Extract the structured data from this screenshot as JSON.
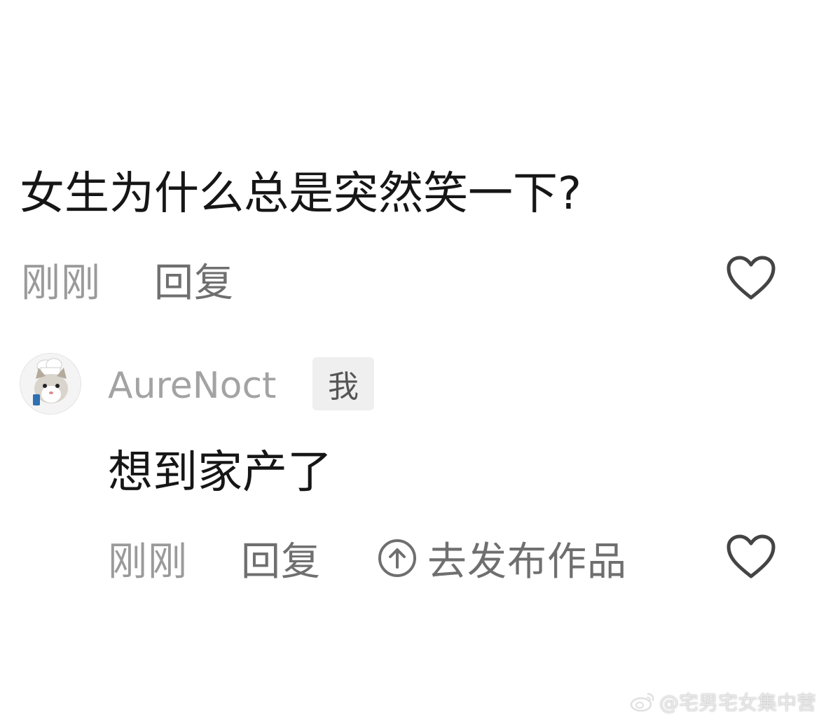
{
  "comment": {
    "text": "女生为什么总是突然笑一下?",
    "time": "刚刚",
    "reply_label": "回复",
    "like_icon": "heart-outline-icon"
  },
  "reply": {
    "avatar_icon": "cat-chef-avatar",
    "username": "AureNoct",
    "badge": "我",
    "text": "想到家产了",
    "time": "刚刚",
    "reply_label": "回复",
    "publish_icon": "arrow-up-circle-icon",
    "publish_label": "去发布作品",
    "like_icon": "heart-outline-icon"
  },
  "watermark": {
    "text": "@宅男宅女集中营",
    "icon": "weibo-logo-icon"
  },
  "colors": {
    "primary_text": "#161616",
    "secondary_text": "#9a9a9a",
    "action_text": "#6f6f6f",
    "badge_bg": "#efefef"
  }
}
